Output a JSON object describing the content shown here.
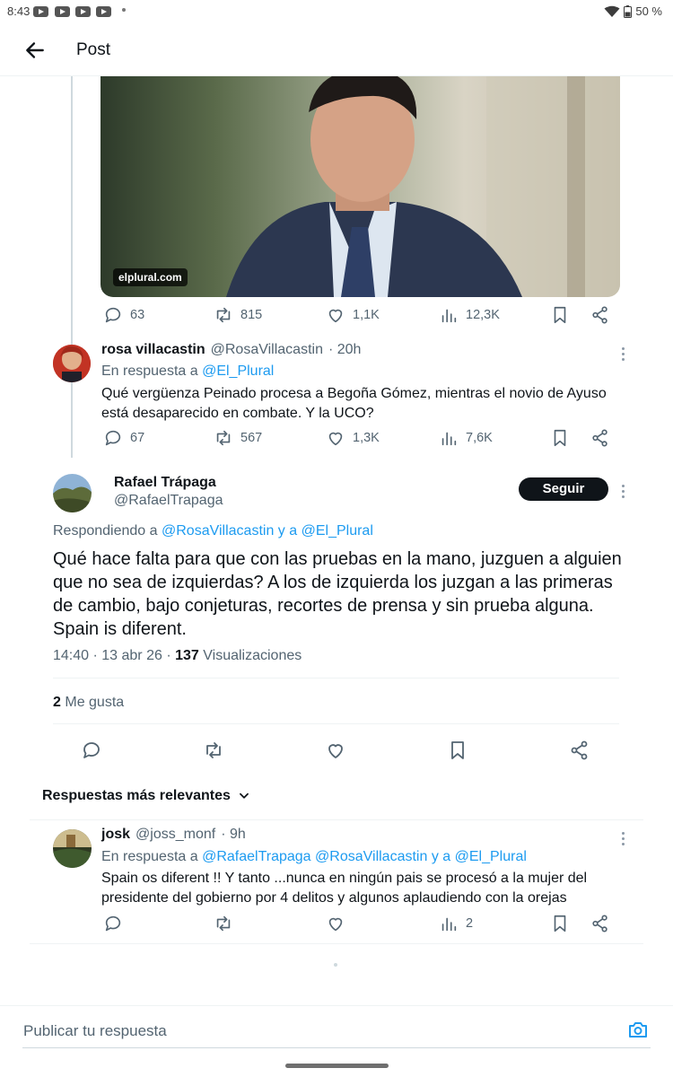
{
  "status_bar": {
    "time": "8:43",
    "battery": "50 %"
  },
  "header": {
    "title": "Post"
  },
  "image_card": {
    "source": "elplural.com"
  },
  "quoted_post_stats": {
    "replies": "63",
    "reposts": "815",
    "likes": "1,1K",
    "views": "12,3K"
  },
  "parent_reply": {
    "name": "rosa villacastin",
    "handle": "@RosaVillacastin",
    "time": "· 20h",
    "reply_prefix": "En respuesta a",
    "reply_to": "@El_Plural",
    "text_line1": "Qué vergüenza Peinado procesa a Begoña Gómez, mientras el novio de Ayuso",
    "text_line2": "está desaparecido en combate. Y la UCO?",
    "stats": {
      "replies": "67",
      "reposts": "567",
      "likes": "1,3K",
      "views": "7,6K"
    }
  },
  "main_post": {
    "name": "Rafael Trápaga",
    "handle": "@RafaelTrapaga",
    "follow_label": "Seguir",
    "replying_prefix": "Respondiendo a",
    "replying_to_1": "@RosaVillacastin",
    "replying_join": "y a",
    "replying_to_2": "@El_Plural",
    "text": "Qué hace falta para que con las pruebas en la mano, juzguen a alguien que no sea de izquierdas? A los de izquierda los juzgan a las primeras de cambio, bajo conjeturas, recortes de prensa y sin prueba alguna. Spain is diferent.",
    "time": "14:40 · 13 abr 26 ·",
    "views_count": "137",
    "views_label": "Visualizaciones",
    "likes_count": "2",
    "likes_label": "Me gusta"
  },
  "sort_label": "Respuestas más relevantes",
  "reply": {
    "name": "josk",
    "handle": "@joss_monf",
    "time": "· 9h",
    "reply_prefix": "En respuesta a",
    "reply_to_1": "@RafaelTrapaga",
    "reply_to_2": "@RosaVillacastin",
    "reply_join": "y a",
    "reply_to_3": "@El_Plural",
    "text_line1": "Spain os diferent !! Y tanto ...nunca en ningún pais se procesó a la mujer del",
    "text_line2": "presidente del gobierno por 4 delitos y algunos aplaudiendo con la orejas",
    "views": "2"
  },
  "compose": {
    "placeholder": "Publicar tu respuesta"
  }
}
